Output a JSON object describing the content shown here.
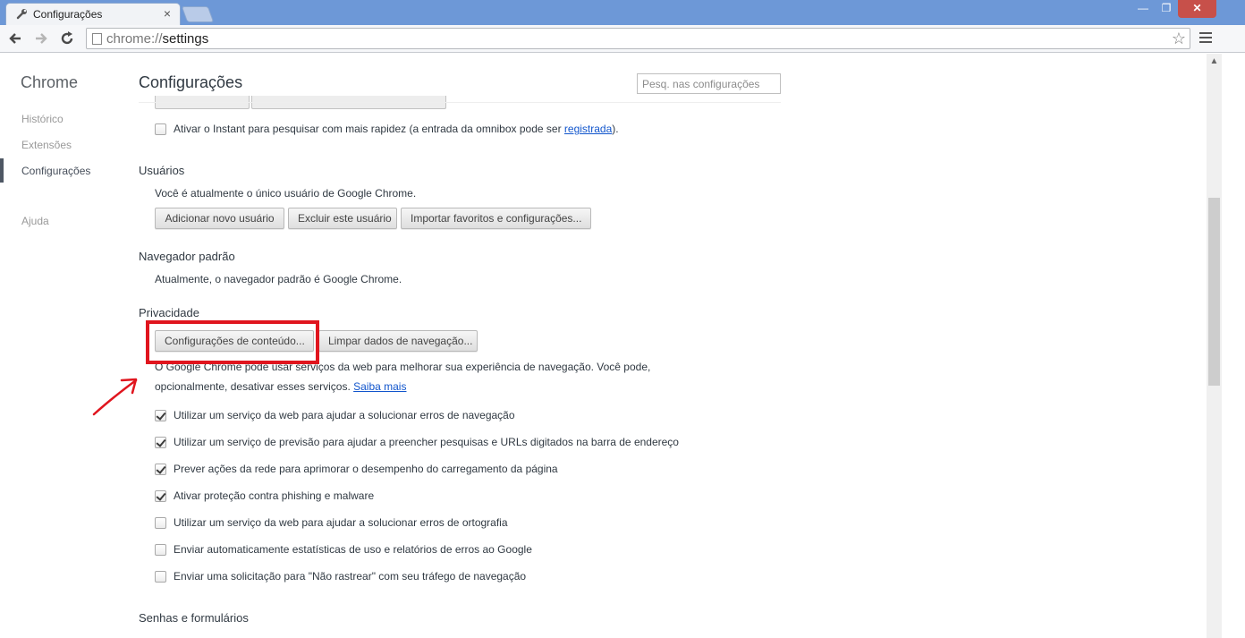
{
  "browser": {
    "tab_title": "Configurações",
    "tab_close": "×",
    "url_scheme": "chrome://",
    "url_path": "settings",
    "star": "☆",
    "win_min": "—",
    "win_max": "❐",
    "win_close": "✕"
  },
  "sidebar": {
    "title": "Chrome",
    "items": [
      {
        "label": "Histórico"
      },
      {
        "label": "Extensões"
      },
      {
        "label": "Configurações",
        "selected": true
      },
      {
        "label": "Ajuda"
      }
    ]
  },
  "main": {
    "title": "Configurações",
    "search_placeholder": "Pesq. nas configurações",
    "search": {
      "instant_label": "Ativar o Instant para pesquisar com mais rapidez (a entrada da omnibox pode ser ",
      "instant_link": "registrada",
      "instant_suffix": ").",
      "instant_checked": false
    },
    "users": {
      "title": "Usuários",
      "description": "Você é atualmente o único usuário de Google Chrome.",
      "buttons": [
        "Adicionar novo usuário",
        "Excluir este usuário",
        "Importar favoritos e configurações..."
      ]
    },
    "default_browser": {
      "title": "Navegador padrão",
      "description": "Atualmente, o navegador padrão é Google Chrome."
    },
    "privacy": {
      "title": "Privacidade",
      "buttons": [
        "Configurações de conteúdo...",
        "Limpar dados de navegação..."
      ],
      "description_line1": "O Google Chrome pode usar serviços da web para melhorar sua experiência de navegação. Você pode,",
      "description_line2": "opcionalmente, desativar esses serviços. ",
      "learn_more": "Saiba mais",
      "options": [
        {
          "label": "Utilizar um serviço da web para ajudar a solucionar erros de navegação",
          "checked": true
        },
        {
          "label": "Utilizar um serviço de previsão para ajudar a preencher pesquisas e URLs digitados na barra de endereço",
          "checked": true
        },
        {
          "label": "Prever ações da rede para aprimorar o desempenho do carregamento da página",
          "checked": true
        },
        {
          "label": "Ativar proteção contra phishing e malware",
          "checked": true
        },
        {
          "label": "Utilizar um serviço da web para ajudar a solucionar erros de ortografia",
          "checked": false
        },
        {
          "label": "Enviar automaticamente estatísticas de uso e relatórios de erros ao Google",
          "checked": false
        },
        {
          "label": "Enviar uma solicitação para \"Não rastrear\" com seu tráfego de navegação",
          "checked": false
        }
      ]
    },
    "passwords": {
      "title": "Senhas e formulários"
    }
  },
  "annotation": {
    "color": "#e0151e"
  }
}
